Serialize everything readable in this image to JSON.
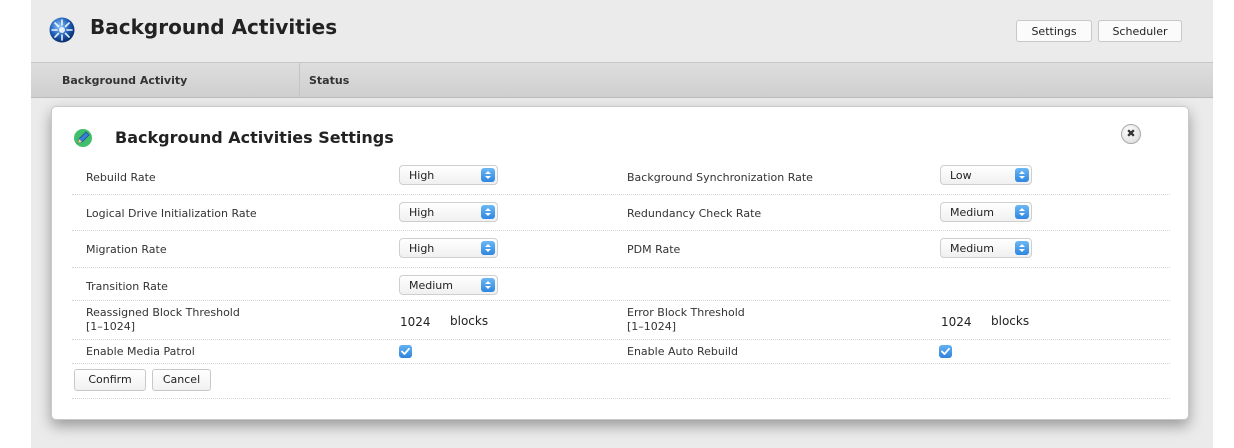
{
  "app": {
    "title": "Background Activities",
    "header_buttons": {
      "settings": "Settings",
      "scheduler": "Scheduler"
    }
  },
  "table": {
    "columns": [
      "Background Activity",
      "Status"
    ]
  },
  "modal": {
    "title": "Background Activities Settings",
    "close_icon": "close-icon",
    "fields": {
      "rebuild_rate": {
        "label": "Rebuild Rate",
        "value": "High"
      },
      "logical_drive_init_rate": {
        "label": "Logical Drive Initialization Rate",
        "value": "High"
      },
      "migration_rate": {
        "label": "Migration Rate",
        "value": "High"
      },
      "transition_rate": {
        "label": "Transition Rate",
        "value": "Medium"
      },
      "background_sync_rate": {
        "label": "Background Synchronization Rate",
        "value": "Low"
      },
      "redundancy_check_rate": {
        "label": "Redundancy Check Rate",
        "value": "Medium"
      },
      "pdm_rate": {
        "label": "PDM Rate",
        "value": "Medium"
      },
      "reassigned_block_threshold": {
        "label": "Reassigned Block Threshold",
        "range": "[1–1024]",
        "value": "1024",
        "unit": "blocks"
      },
      "error_block_threshold": {
        "label": "Error Block Threshold",
        "range": "[1–1024]",
        "value": "1024",
        "unit": "blocks"
      },
      "enable_media_patrol": {
        "label": "Enable Media Patrol",
        "checked": true
      },
      "enable_auto_rebuild": {
        "label": "Enable Auto Rebuild",
        "checked": true
      }
    },
    "buttons": {
      "confirm": "Confirm",
      "cancel": "Cancel"
    }
  },
  "colors": {
    "accent_blue": "#2f86e0",
    "page_background": "#ebebeb",
    "header_bar": "#d6d6d6"
  }
}
